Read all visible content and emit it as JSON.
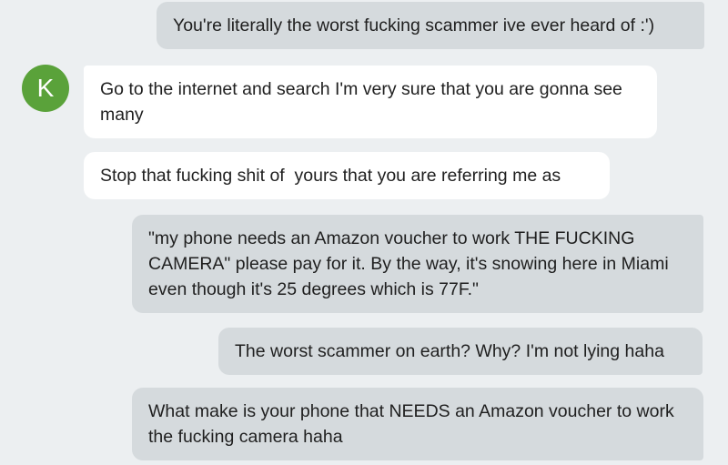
{
  "contact": {
    "avatar_initial": "K",
    "avatar_color": "#5aa23a"
  },
  "colors": {
    "background": "#eceff1",
    "sent_bubble": "#d5dadd",
    "received_bubble": "#ffffff"
  },
  "messages": [
    {
      "direction": "sent",
      "text": "You're literally the worst fucking scammer ive ever heard of :')"
    },
    {
      "direction": "received",
      "text": "Go to the internet and search I'm very sure that you are gonna see many"
    },
    {
      "direction": "received",
      "text": "Stop that fucking shit of  yours that you are referring me as"
    },
    {
      "direction": "sent",
      "text": "\"my phone needs an Amazon voucher to work THE FUCKING CAMERA\" please pay for it. By the way, it's snowing here in Miami even though it's 25 degrees which is 77F.\""
    },
    {
      "direction": "sent",
      "text": "The worst scammer on earth? Why? I'm not lying haha"
    },
    {
      "direction": "sent",
      "text": "What make is your phone that NEEDS an Amazon voucher to work the fucking camera haha"
    }
  ]
}
